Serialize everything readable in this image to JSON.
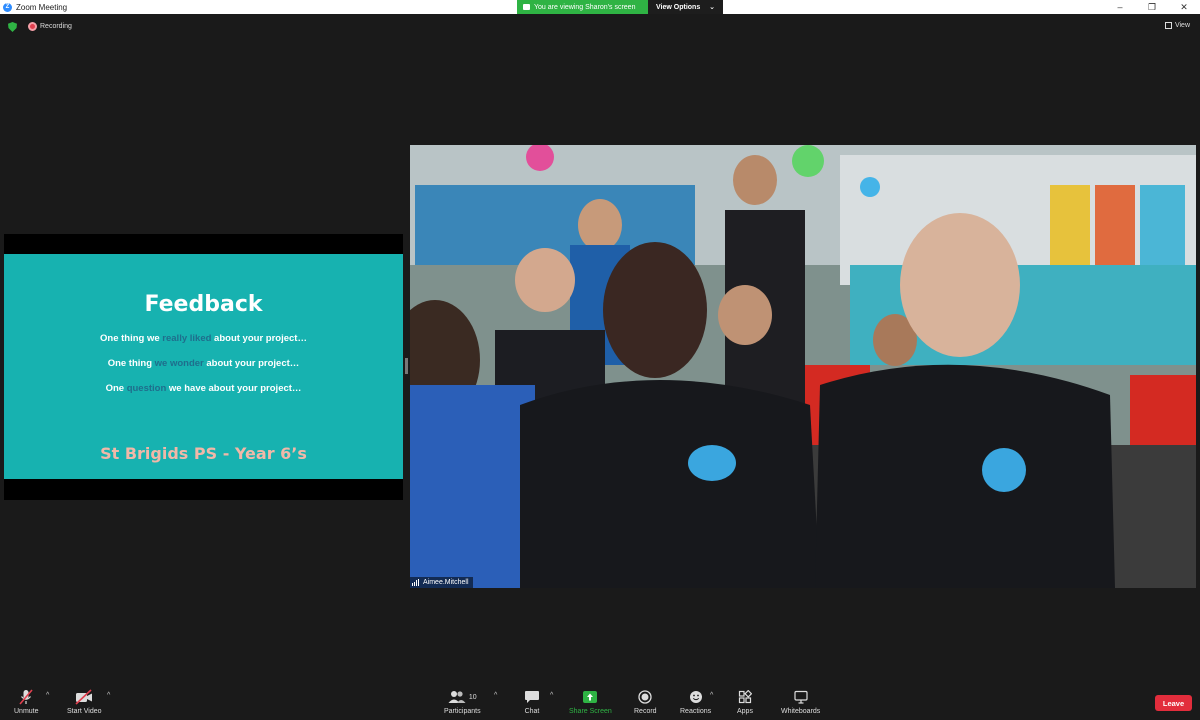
{
  "window": {
    "title": "Zoom Meeting",
    "controls": [
      "–",
      "❐",
      "✕"
    ]
  },
  "banner": {
    "viewing_text": "You are viewing Sharon's screen",
    "view_options_label": "View Options",
    "view_options_caret": "⌄"
  },
  "status": {
    "recording_label": "Recording",
    "view_label": "View"
  },
  "slide": {
    "title": "Feedback",
    "line1_pre": "One thing we ",
    "line1_hl": "really liked",
    "line1_post": " about your project…",
    "line2_pre": "One thing ",
    "line2_hl": "we wonder",
    "line2_post": " about your project…",
    "line3_pre": "One ",
    "line3_hl": "question",
    "line3_post": " we have about your project…",
    "school": "St Brigids PS - Year 6’s",
    "bg_color": "#17b2b0",
    "highlight_color": "#1f6e8c",
    "school_color": "#f1b8a8"
  },
  "video": {
    "participant_name": "Aimee.Mitchell"
  },
  "toolbar": {
    "unmute_label": "Unmute",
    "start_video_label": "Start Video",
    "participants_label": "Participants",
    "participants_count": "10",
    "chat_label": "Chat",
    "share_screen_label": "Share Screen",
    "record_label": "Record",
    "reactions_label": "Reactions",
    "apps_label": "Apps",
    "whiteboards_label": "Whiteboards",
    "leave_label": "Leave",
    "caret": "^"
  },
  "colors": {
    "share_green": "#2fb344",
    "leave_red": "#e22d3c",
    "mute_red": "#e2404f"
  }
}
